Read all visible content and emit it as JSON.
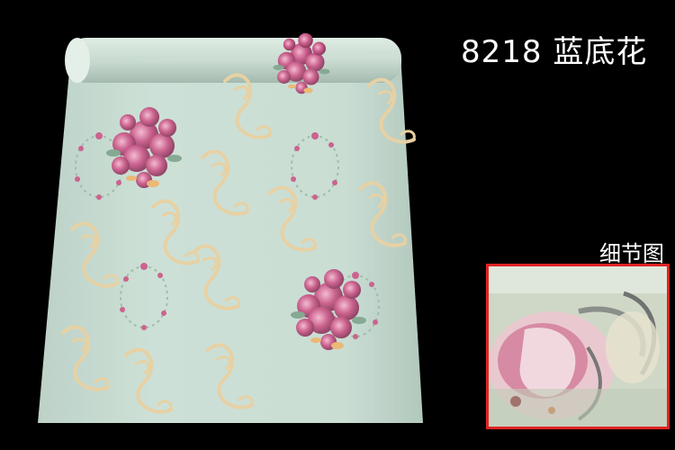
{
  "product": {
    "title": "8218  蓝底花",
    "detail_label": "细节图"
  },
  "colors": {
    "background": "#000000",
    "wallpaper_base": "#c9dcd2",
    "rose": "#c25b86",
    "scroll_ornament": "#e6cf9f",
    "detail_border": "#e02323"
  }
}
